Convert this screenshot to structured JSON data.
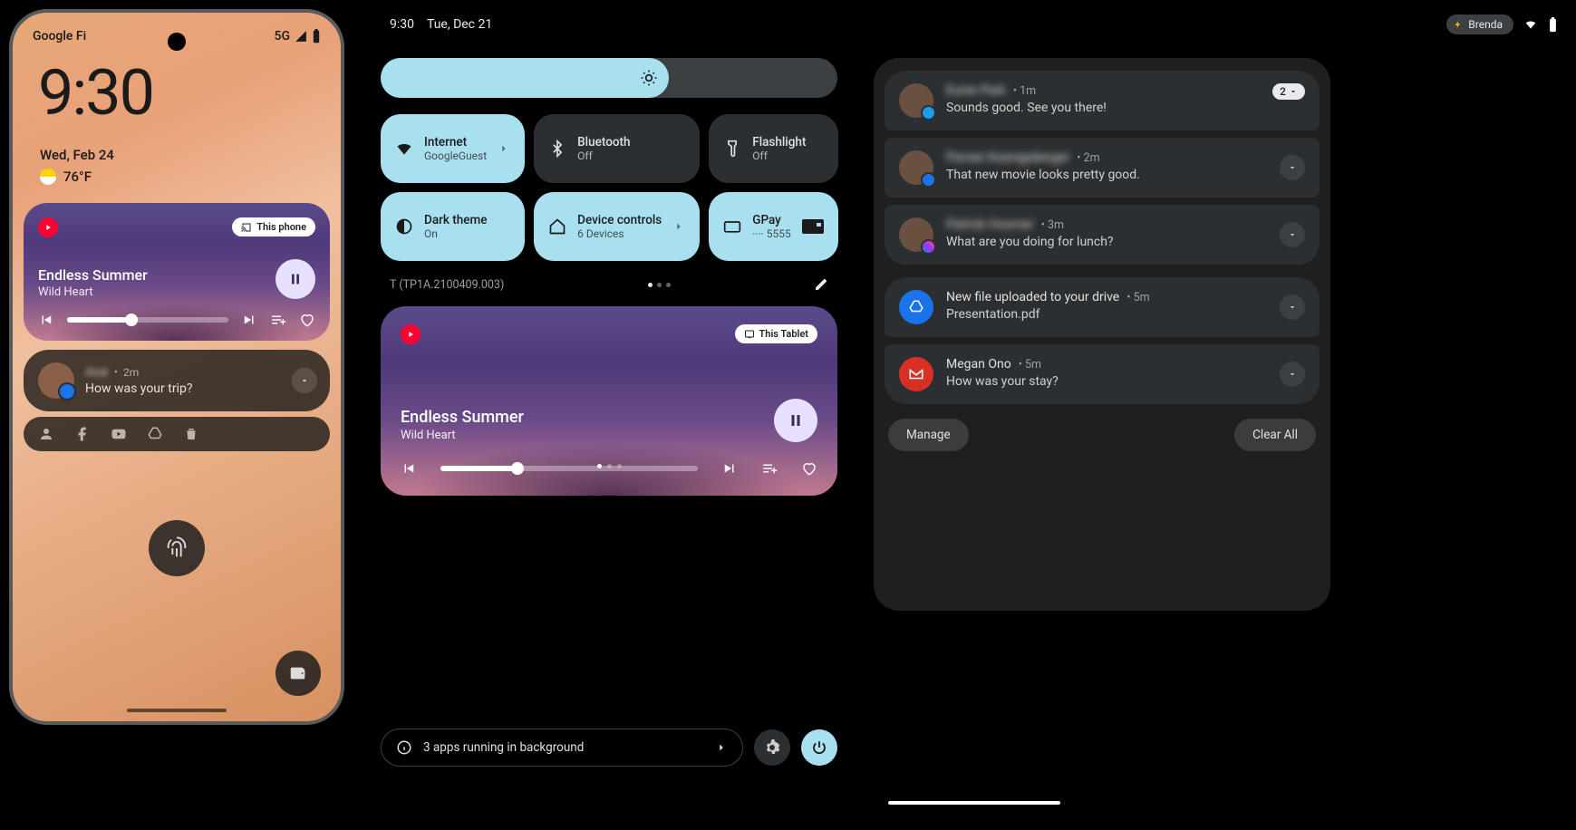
{
  "phone": {
    "statusbar": {
      "carrier": "Google Fi",
      "network": "5G"
    },
    "clock": "9:30",
    "date": "Wed, Feb 24",
    "temp": "76°F",
    "media": {
      "cast": "This phone",
      "song": "Endless Summer",
      "artist": "Wild Heart"
    },
    "notif": {
      "name": "Alok",
      "time": "2m",
      "msg": "How was your trip?"
    }
  },
  "tablet": {
    "statusbar": {
      "time": "9:30",
      "date": "Tue, Dec 21",
      "user": "Brenda"
    },
    "tiles": [
      {
        "label": "Internet",
        "sub": "GoogleGuest",
        "on": true,
        "icon": "wifi",
        "chevron": true
      },
      {
        "label": "Bluetooth",
        "sub": "Off",
        "on": false,
        "icon": "bluetooth"
      },
      {
        "label": "Flashlight",
        "sub": "Off",
        "on": false,
        "icon": "flashlight"
      },
      {
        "label": "Dark theme",
        "sub": "On",
        "on": true,
        "icon": "darktheme"
      },
      {
        "label": "Device controls",
        "sub": "6 Devices",
        "on": true,
        "icon": "home",
        "chevron": true
      },
      {
        "label": "GPay",
        "sub": "···· 5555",
        "on": true,
        "icon": "card",
        "trailing_card": true
      }
    ],
    "build": "T (TP1A.2100409.003)",
    "media": {
      "cast": "This Tablet",
      "song": "Endless Summer",
      "artist": "Wild Heart"
    },
    "running": "3 apps running in background",
    "notifs": [
      {
        "name": "Eunie Park",
        "time": "1m",
        "msg": "Sounds good. See you there!",
        "blur": true,
        "count": "2",
        "badge": "tw",
        "avatar": "person"
      },
      {
        "name": "Florian Koenigsberger",
        "time": "2m",
        "msg": "That new movie looks pretty good.",
        "blur": true,
        "badge": "msg",
        "avatar": "person"
      },
      {
        "name": "Patrick Hosmer",
        "time": "3m",
        "msg": "What are you doing for lunch?",
        "blur": true,
        "badge": "fbm",
        "avatar": "person"
      },
      {
        "name": "New file uploaded to your drive",
        "time": "5m",
        "msg": "Presentation.pdf",
        "blur": false,
        "avatar": "drive"
      },
      {
        "name": "Megan Ono",
        "time": "5m",
        "msg": "How was your stay?",
        "blur": false,
        "avatar": "gmail"
      }
    ],
    "manage": "Manage",
    "clear": "Clear All"
  }
}
